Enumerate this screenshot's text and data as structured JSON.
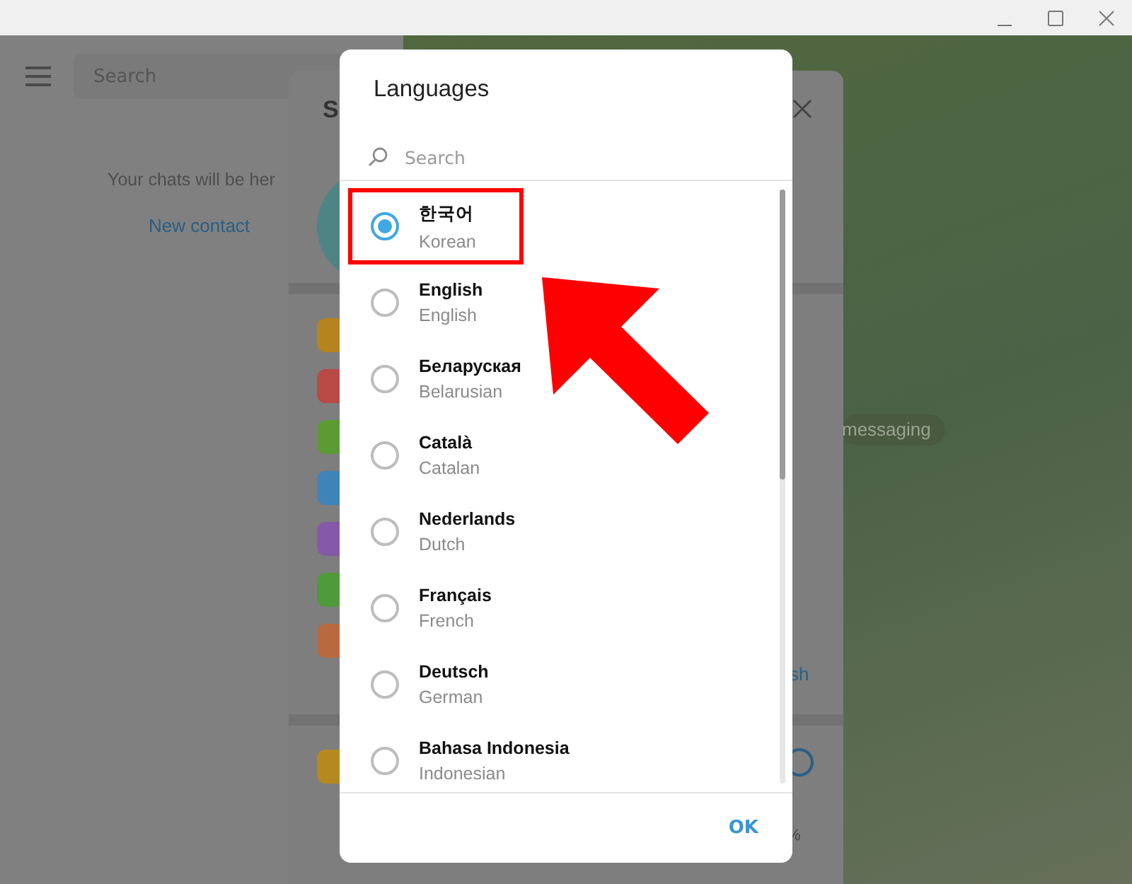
{
  "chat_list": {
    "search": {
      "placeholder": "Search"
    },
    "empty_text": "Your chats will be her",
    "new_contact": "New contact"
  },
  "settings": {
    "title_fragment": "S",
    "item_fragment": "sh",
    "percent_fragment": "%"
  },
  "chat": {
    "service_message": "messaging"
  },
  "dialog": {
    "title": "Languages",
    "search": {
      "placeholder": "Search"
    },
    "languages": [
      {
        "name": "한국어",
        "english": "Korean",
        "selected": true,
        "highlighted": true
      },
      {
        "name": "English",
        "english": "English",
        "selected": false,
        "highlighted": false
      },
      {
        "name": "Беларуская",
        "english": "Belarusian",
        "selected": false,
        "highlighted": false
      },
      {
        "name": "Català",
        "english": "Catalan",
        "selected": false,
        "highlighted": false
      },
      {
        "name": "Nederlands",
        "english": "Dutch",
        "selected": false,
        "highlighted": false
      },
      {
        "name": "Français",
        "english": "French",
        "selected": false,
        "highlighted": false
      },
      {
        "name": "Deutsch",
        "english": "German",
        "selected": false,
        "highlighted": false
      },
      {
        "name": "Bahasa Indonesia",
        "english": "Indonesian",
        "selected": false,
        "highlighted": false
      }
    ],
    "ok": "OK"
  }
}
